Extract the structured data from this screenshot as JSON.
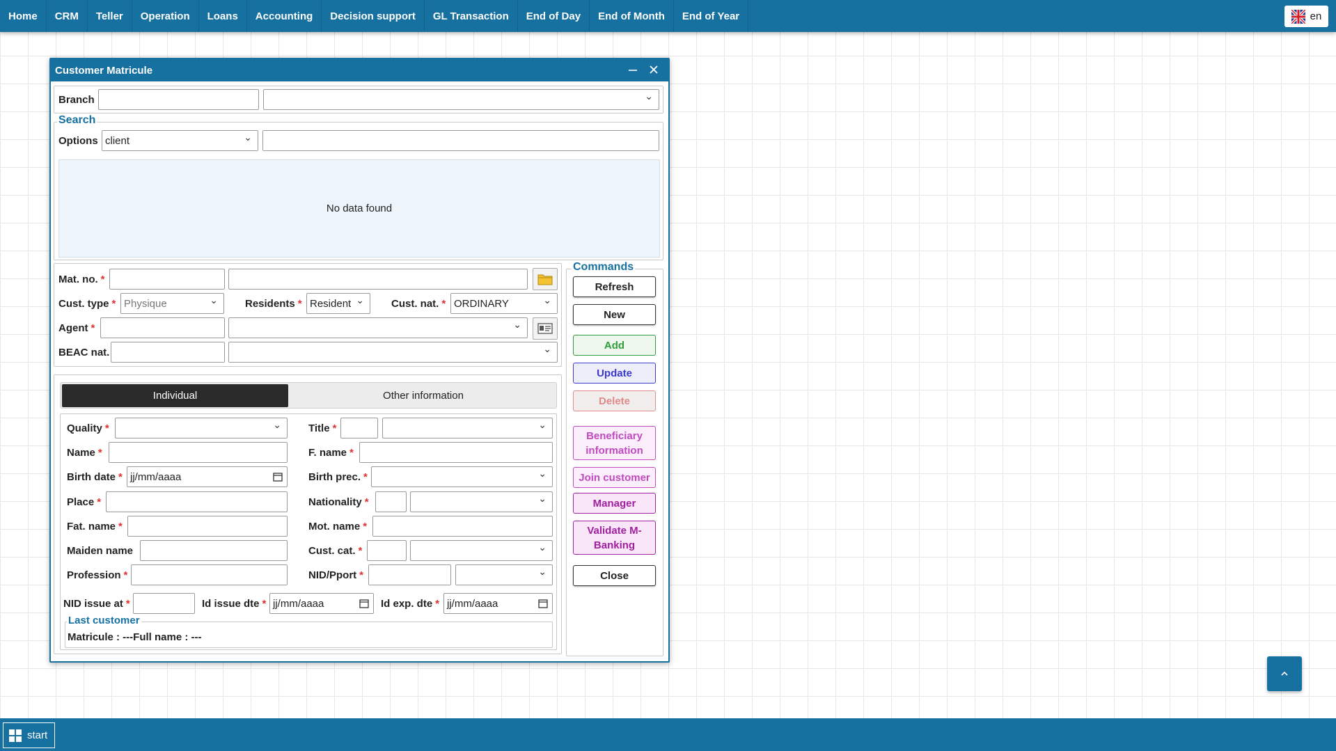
{
  "nav": {
    "items": [
      "Home",
      "CRM",
      "Teller",
      "Operation",
      "Loans",
      "Accounting",
      "Decision support",
      "GL Transaction",
      "End of Day",
      "End of Month",
      "End of Year"
    ],
    "language": "en"
  },
  "window": {
    "title": "Customer Matricule",
    "branch": {
      "label": "Branch",
      "code_value": "",
      "name_value": ""
    },
    "search": {
      "legend": "Search",
      "options_label": "Options",
      "options_value": "client",
      "query_value": "",
      "no_data_text": "No data found"
    },
    "identity": {
      "mat_no_label": "Mat. no.",
      "cust_type_label": "Cust. type",
      "cust_type_value": "Physique",
      "residents_label": "Residents",
      "residents_value": "Resident",
      "cust_nat_label": "Cust. nat.",
      "cust_nat_value": "ORDINARY",
      "agent_label": "Agent",
      "beac_nat_label": "BEAC nat."
    },
    "tabs": {
      "individual": "Individual",
      "other": "Other information"
    },
    "individual": {
      "quality_label": "Quality",
      "title_label": "Title",
      "name_label": "Name",
      "fname_label": "F. name",
      "birth_date_label": "Birth date",
      "birth_date_value": "jj/mm/aaaa",
      "birth_prec_label": "Birth prec.",
      "place_label": "Place",
      "nationality_label": "Nationality",
      "fat_name_label": "Fat. name",
      "mot_name_label": "Mot. name",
      "maiden_name_label": "Maiden name",
      "cust_cat_label": "Cust. cat.",
      "profession_label": "Profession",
      "nid_pport_label": "NID/Pport",
      "nid_issue_at_label": "NID issue at",
      "id_issue_dte_label": "Id issue dte",
      "id_issue_dte_value": "jj/mm/aaaa",
      "id_exp_dte_label": "Id exp. dte",
      "id_exp_dte_value": "jj/mm/aaaa"
    },
    "last_customer": {
      "legend": "Last customer",
      "text": "Matricule : ---Full name : ---"
    },
    "commands": {
      "legend": "Commands",
      "refresh": "Refresh",
      "new": "New",
      "add": "Add",
      "update": "Update",
      "delete": "Delete",
      "beneficiary": "Beneficiary information",
      "join": "Join customer",
      "manager": "Manager",
      "validate": "Validate M-Banking",
      "close": "Close"
    }
  },
  "taskbar": {
    "start_label": "start"
  },
  "colors": {
    "primary": "#1670a0",
    "add": "#2e9e3a",
    "update": "#3a3ad0",
    "delete": "#e08a8a",
    "purple": "#c04ac0",
    "required": "#e03030"
  }
}
